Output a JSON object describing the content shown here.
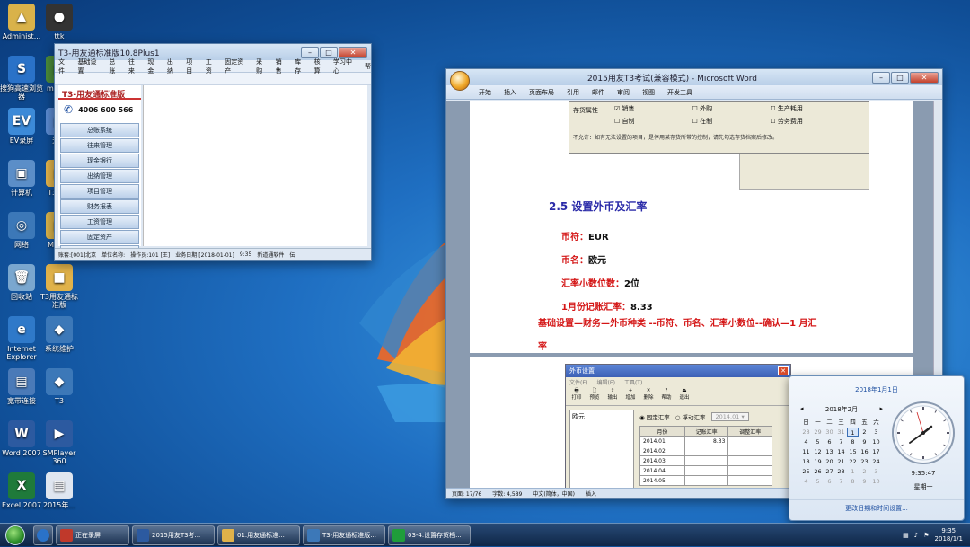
{
  "desktop_icons": [
    {
      "label": "Administ...",
      "color": "#d9b24a",
      "glyph": "▲"
    },
    {
      "label": "ttk",
      "color": "#333333",
      "glyph": "●"
    },
    {
      "label": "搜狗高速浏览器",
      "color": "#2a72c8",
      "glyph": "S"
    },
    {
      "label": "mcs_...",
      "color": "#4a8a3a",
      "glyph": "■"
    },
    {
      "label": "EV录屏",
      "color": "#3c8ad8",
      "glyph": "EV"
    },
    {
      "label": "天...",
      "color": "#5a8ad0",
      "glyph": "■"
    },
    {
      "label": "计算机",
      "color": "#5b8ec8",
      "glyph": "▣"
    },
    {
      "label": "T3用...",
      "color": "#e0b24a",
      "glyph": "■"
    },
    {
      "label": "网络",
      "color": "#3c78b8",
      "glyph": "◎"
    },
    {
      "label": "MSD...",
      "color": "#d8b24a",
      "glyph": "■"
    },
    {
      "label": "回收站",
      "color": "#7aa7cf",
      "glyph": "🗑"
    },
    {
      "label": "T3用友通标准版",
      "color": "#e0b24a",
      "glyph": "■"
    },
    {
      "label": "Internet Explorer",
      "color": "#2f79c9",
      "glyph": "e"
    },
    {
      "label": "系统维护",
      "color": "#3c78b8",
      "glyph": "◆"
    },
    {
      "label": "宽带连接",
      "color": "#4a7ab8",
      "glyph": "▤"
    },
    {
      "label": "T3",
      "color": "#3c78b8",
      "glyph": "◆"
    },
    {
      "label": "Word 2007",
      "color": "#2c5aa0",
      "glyph": "W"
    },
    {
      "label": "SMPlayer 360",
      "color": "#2c5aa0",
      "glyph": "▶"
    },
    {
      "label": "Excel 2007",
      "color": "#1f7a3a",
      "glyph": "X"
    },
    {
      "label": "2015年...",
      "color": "#dfe6f0",
      "glyph": "▤"
    }
  ],
  "t3_window": {
    "title": "T3-用友通标准版10.8Plus1",
    "menu": [
      "文件",
      "基础设置",
      "总账",
      "往来",
      "现金",
      "出纳",
      "项目",
      "工资",
      "固定资产",
      "采购",
      "销售",
      "库存",
      "核算",
      "学习中心",
      "帮"
    ],
    "brand": "T3-用友通标准版",
    "phone": "4006 600 566",
    "nav": [
      "总账系统",
      "往来管理",
      "现金银行",
      "出纳管理",
      "项目管理",
      "财务报表",
      "工资管理",
      "固定资产",
      "采购管理"
    ],
    "status": [
      "账套:[001]北京",
      "单位名称:",
      "操作员:101 [王]",
      "业务日期:[2018-01-01]",
      "9:35",
      "新道通软件",
      "伝"
    ]
  },
  "word_window": {
    "title": "2015用友T3考试(兼容模式) - Microsoft Word",
    "tabs": [
      "开始",
      "插入",
      "页面布局",
      "引用",
      "邮件",
      "审阅",
      "视图",
      "开发工具"
    ],
    "doc_form": {
      "label": "存货属性",
      "checks": [
        "销售",
        "外购",
        "生产耗用",
        "自制",
        "在制",
        "劳务费用"
      ],
      "note": "不允许：如有无法设置的项目，是停用某存货所带的控制，请先勾选存货档案后修改。"
    },
    "heading": "2.5 设置外币及汇率",
    "lines": [
      {
        "label": "币符：",
        "value": "EUR"
      },
      {
        "label": "币名：",
        "value": "欧元"
      },
      {
        "label": "汇率小数位数：",
        "value": "2位"
      },
      {
        "label": "1月份记账汇率：",
        "value": "8.33"
      }
    ],
    "instruction": "基础设置—财务—外币种类 --币符、币名、汇率小数位--确认—1 月汇",
    "instruction_tail": "率",
    "status": [
      "页面: 17/76",
      "字数: 4,589",
      "中文(简体，中国)",
      "插入"
    ]
  },
  "currency_dialog": {
    "title": "外币设置",
    "menu": [
      "文件(E)",
      "编辑(E)",
      "工具(T)"
    ],
    "toolbar": [
      "打印",
      "预览",
      "输出",
      "增加",
      "删除",
      "帮助",
      "退出"
    ],
    "list": [
      "欧元"
    ],
    "radio_fixed": "固定汇率",
    "radio_float": "浮动汇率",
    "year_select": "2014.01",
    "columns": [
      "月份",
      "记账汇率",
      "调整汇率"
    ],
    "rows": [
      [
        "2014.01",
        "8.33",
        ""
      ],
      [
        "2014.02",
        "",
        ""
      ],
      [
        "2014.03",
        "",
        ""
      ],
      [
        "2014.04",
        "",
        ""
      ],
      [
        "2014.05",
        "",
        ""
      ]
    ]
  },
  "calendar": {
    "header_date": "2018年1月1日",
    "month": "2018年2月",
    "weekdays": [
      "日",
      "一",
      "二",
      "三",
      "四",
      "五",
      "六"
    ],
    "days": [
      [
        "28",
        "29",
        "30",
        "31",
        "1",
        "2",
        "3"
      ],
      [
        "4",
        "5",
        "6",
        "7",
        "8",
        "9",
        "10"
      ],
      [
        "11",
        "12",
        "13",
        "14",
        "15",
        "16",
        "17"
      ],
      [
        "18",
        "19",
        "20",
        "21",
        "22",
        "23",
        "24"
      ],
      [
        "25",
        "26",
        "27",
        "28",
        "1",
        "2",
        "3"
      ],
      [
        "4",
        "5",
        "6",
        "7",
        "8",
        "9",
        "10"
      ]
    ],
    "time": "9:35:47",
    "weekday_label": "星期一",
    "change_link": "更改日期和时间设置..."
  },
  "taskbar": {
    "items": [
      {
        "label": "正在录屏",
        "color": "#c0392b"
      },
      {
        "label": "2015用友T3考...",
        "color": "#2c5aa0"
      },
      {
        "label": "01.用友通标准...",
        "color": "#e0b24a"
      },
      {
        "label": "T3-用友通标准版...",
        "color": "#3c78b8"
      },
      {
        "label": "03-4.设置存货档...",
        "color": "#1f9d3a"
      }
    ],
    "time": "9:35",
    "date": "2018/1/1"
  },
  "colors": {
    "accent_red": "#d41515",
    "heading_blue": "#2a2aa8"
  }
}
